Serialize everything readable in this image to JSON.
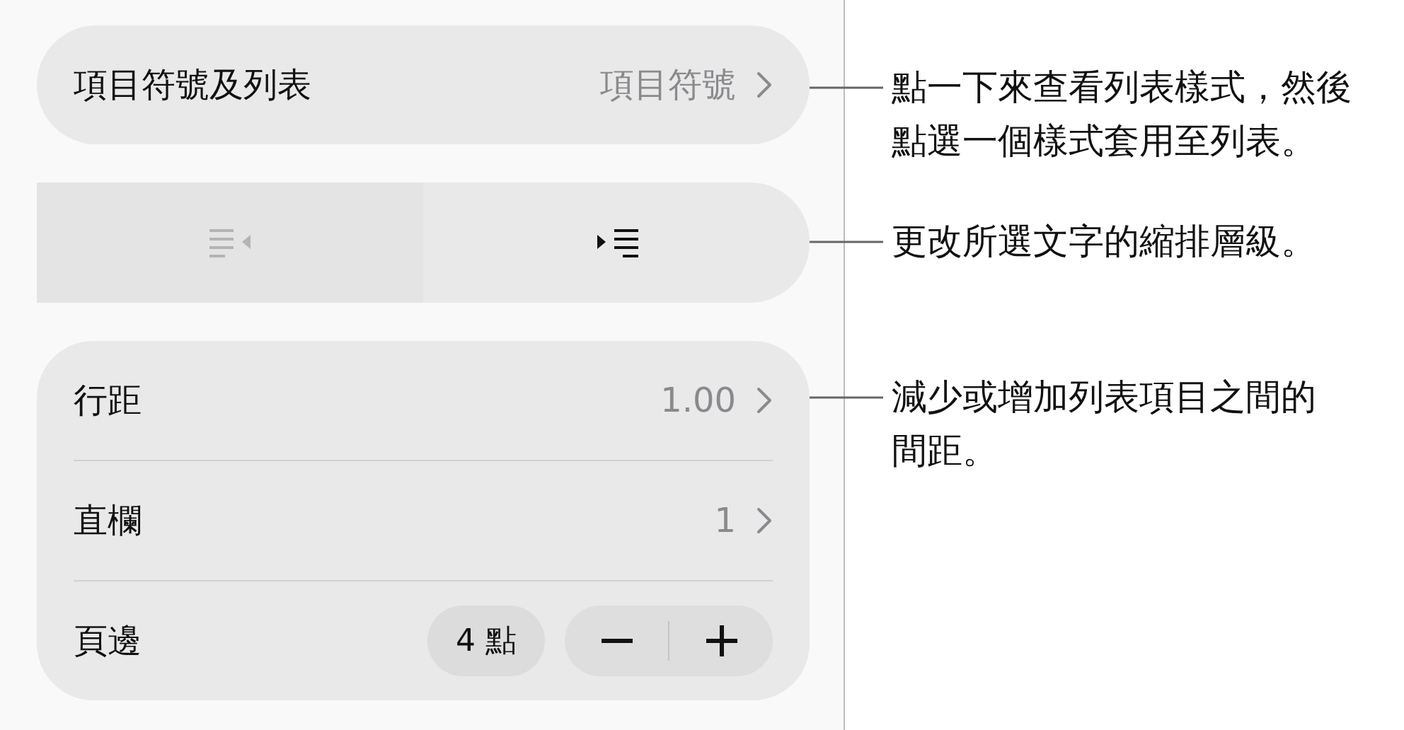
{
  "bullets_row": {
    "label": "項目符號及列表",
    "value": "項目符號"
  },
  "indent_buttons": [
    {
      "kind": "decrease",
      "disabled": true
    },
    {
      "kind": "increase",
      "disabled": false
    }
  ],
  "spacing_rows": [
    {
      "kind": "link",
      "label": "行距",
      "value": "1.00"
    },
    {
      "kind": "link",
      "label": "直欄",
      "value": "1"
    },
    {
      "kind": "stepper",
      "label": "頁邊",
      "value": "4 點"
    }
  ],
  "callouts": [
    "點一下來查看列表樣式，然後點選一個樣式套用至列表。",
    "更改所選文字的縮排層級。",
    "減少或增加列表項目之間的間距。"
  ]
}
